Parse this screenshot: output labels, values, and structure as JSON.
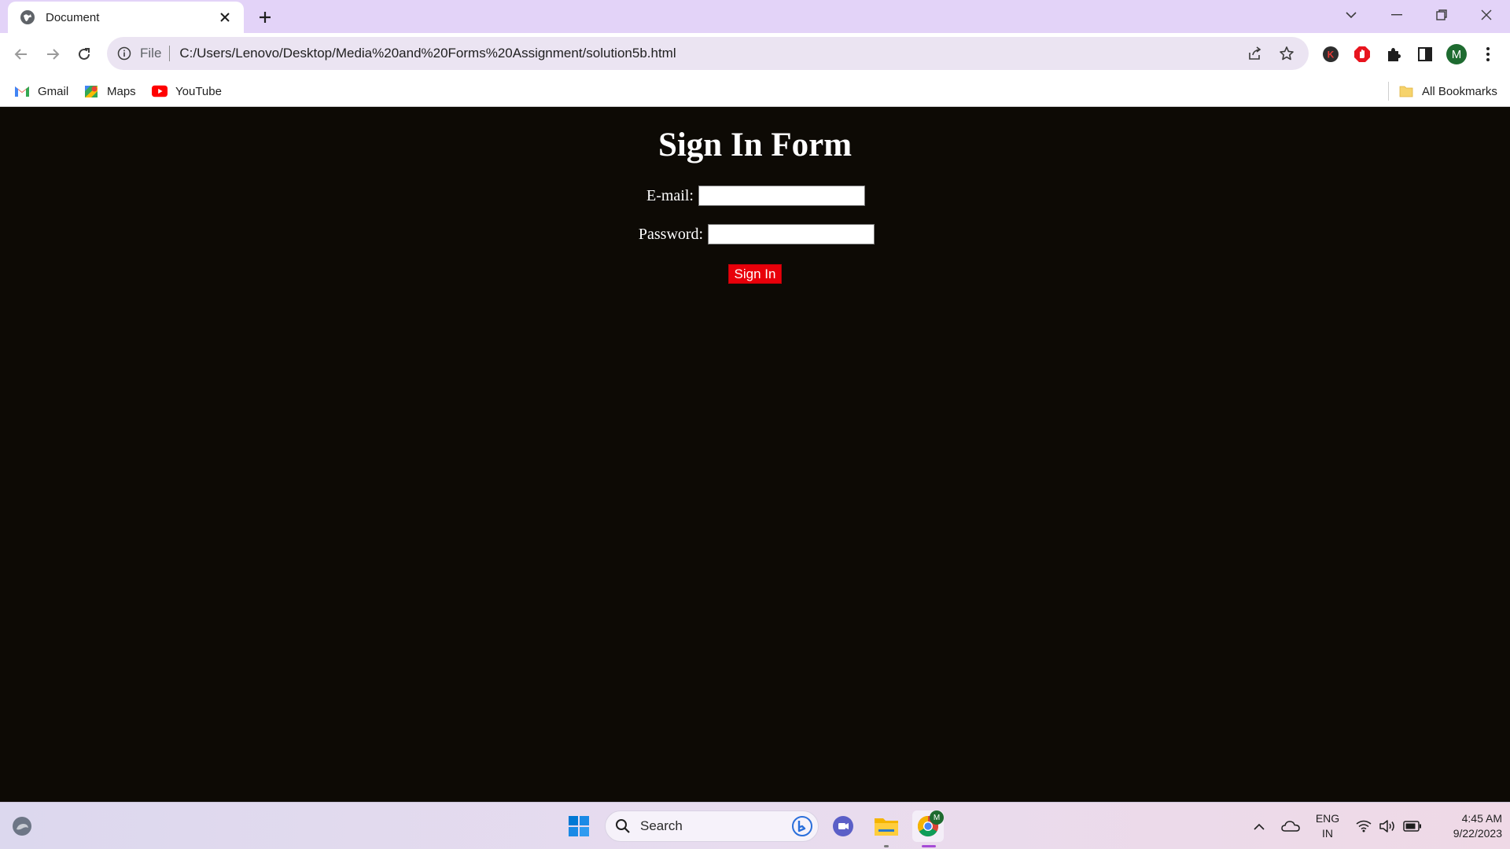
{
  "browser": {
    "tab": {
      "title": "Document",
      "favicon": "globe-icon"
    },
    "address_bar": {
      "scheme_label": "File",
      "url": "C:/Users/Lenovo/Desktop/Media%20and%20Forms%20Assignment/solution5b.html"
    },
    "profile_initial": "M",
    "extensions": [
      "k-extension-icon",
      "adblock-icon",
      "puzzle-icon",
      "side-panel-icon"
    ],
    "bookmarks": [
      {
        "label": "Gmail",
        "icon": "gmail-icon"
      },
      {
        "label": "Maps",
        "icon": "maps-icon"
      },
      {
        "label": "YouTube",
        "icon": "youtube-icon"
      }
    ],
    "all_bookmarks_label": "All Bookmarks"
  },
  "page": {
    "background": "#0d0a05",
    "title": "Sign In Form",
    "email": {
      "label": "E-mail:",
      "value": ""
    },
    "password": {
      "label": "Password:",
      "value": ""
    },
    "submit_label": "Sign In",
    "submit_color": "#e8000a"
  },
  "taskbar": {
    "search_label": "Search",
    "lang_line1": "ENG",
    "lang_line2": "IN",
    "time": "4:45 AM",
    "date": "9/22/2023",
    "chrome_badge": "M"
  }
}
